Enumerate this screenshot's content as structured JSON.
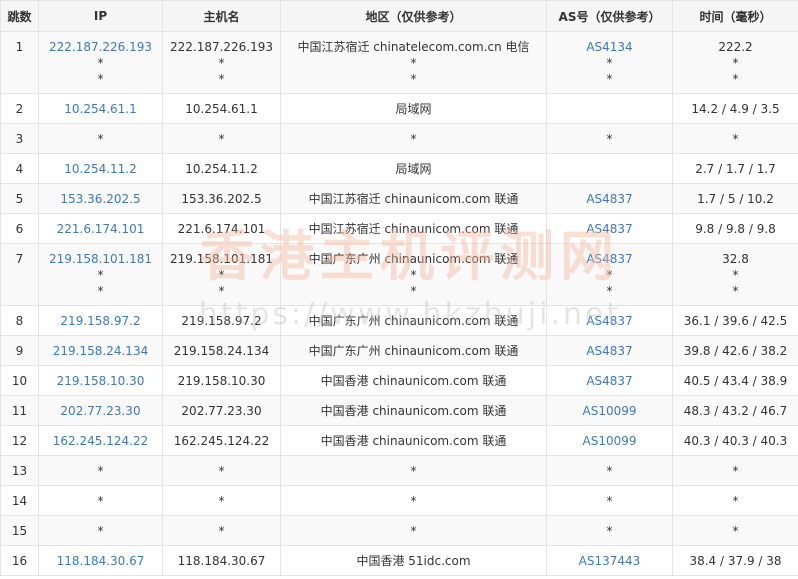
{
  "headers": [
    "跳数",
    "IP",
    "主机名",
    "地区（仅供参考）",
    "AS号（仅供参考）",
    "时间（毫秒）"
  ],
  "rows": [
    {
      "hop": "1",
      "ip": [
        "222.187.226.193",
        "*",
        "*"
      ],
      "host": [
        "222.187.226.193",
        "*",
        "*"
      ],
      "region": [
        "中国江苏宿迁 chinatelecom.com.cn 电信",
        "*",
        "*"
      ],
      "as": [
        "AS4134",
        "*",
        "*"
      ],
      "time": [
        "222.2",
        "*",
        "*"
      ]
    },
    {
      "hop": "2",
      "ip": [
        "10.254.61.1"
      ],
      "host": [
        "10.254.61.1"
      ],
      "region": [
        "局域网"
      ],
      "as": [
        ""
      ],
      "time": [
        "14.2 / 4.9 / 3.5"
      ]
    },
    {
      "hop": "3",
      "ip": [
        "*"
      ],
      "host": [
        "*"
      ],
      "region": [
        "*"
      ],
      "as": [
        "*"
      ],
      "time": [
        "*"
      ]
    },
    {
      "hop": "4",
      "ip": [
        "10.254.11.2"
      ],
      "host": [
        "10.254.11.2"
      ],
      "region": [
        "局域网"
      ],
      "as": [
        ""
      ],
      "time": [
        "2.7 / 1.7 / 1.7"
      ]
    },
    {
      "hop": "5",
      "ip": [
        "153.36.202.5"
      ],
      "host": [
        "153.36.202.5"
      ],
      "region": [
        "中国江苏宿迁 chinaunicom.com 联通"
      ],
      "as": [
        "AS4837"
      ],
      "time": [
        "1.7 / 5 / 10.2"
      ]
    },
    {
      "hop": "6",
      "ip": [
        "221.6.174.101"
      ],
      "host": [
        "221.6.174.101"
      ],
      "region": [
        "中国江苏宿迁 chinaunicom.com 联通"
      ],
      "as": [
        "AS4837"
      ],
      "time": [
        "9.8 / 9.8 / 9.8"
      ]
    },
    {
      "hop": "7",
      "ip": [
        "219.158.101.181",
        "*",
        "*"
      ],
      "host": [
        "219.158.101.181",
        "*",
        "*"
      ],
      "region": [
        "中国广东广州 chinaunicom.com 联通",
        "*",
        "*"
      ],
      "as": [
        "AS4837",
        "*",
        "*"
      ],
      "time": [
        "32.8",
        "*",
        "*"
      ]
    },
    {
      "hop": "8",
      "ip": [
        "219.158.97.2"
      ],
      "host": [
        "219.158.97.2"
      ],
      "region": [
        "中国广东广州 chinaunicom.com 联通"
      ],
      "as": [
        "AS4837"
      ],
      "time": [
        "36.1 / 39.6 / 42.5"
      ]
    },
    {
      "hop": "9",
      "ip": [
        "219.158.24.134"
      ],
      "host": [
        "219.158.24.134"
      ],
      "region": [
        "中国广东广州 chinaunicom.com 联通"
      ],
      "as": [
        "AS4837"
      ],
      "time": [
        "39.8 / 42.6 / 38.2"
      ]
    },
    {
      "hop": "10",
      "ip": [
        "219.158.10.30"
      ],
      "host": [
        "219.158.10.30"
      ],
      "region": [
        "中国香港 chinaunicom.com 联通"
      ],
      "as": [
        "AS4837"
      ],
      "time": [
        "40.5 / 43.4 / 38.9"
      ]
    },
    {
      "hop": "11",
      "ip": [
        "202.77.23.30"
      ],
      "host": [
        "202.77.23.30"
      ],
      "region": [
        "中国香港 chinaunicom.com 联通"
      ],
      "as": [
        "AS10099"
      ],
      "time": [
        "48.3 / 43.2 / 46.7"
      ]
    },
    {
      "hop": "12",
      "ip": [
        "162.245.124.22"
      ],
      "host": [
        "162.245.124.22"
      ],
      "region": [
        "中国香港 chinaunicom.com 联通"
      ],
      "as": [
        "AS10099"
      ],
      "time": [
        "40.3 / 40.3 / 40.3"
      ]
    },
    {
      "hop": "13",
      "ip": [
        "*"
      ],
      "host": [
        "*"
      ],
      "region": [
        "*"
      ],
      "as": [
        "*"
      ],
      "time": [
        "*"
      ]
    },
    {
      "hop": "14",
      "ip": [
        "*"
      ],
      "host": [
        "*"
      ],
      "region": [
        "*"
      ],
      "as": [
        "*"
      ],
      "time": [
        "*"
      ]
    },
    {
      "hop": "15",
      "ip": [
        "*"
      ],
      "host": [
        "*"
      ],
      "region": [
        "*"
      ],
      "as": [
        "*"
      ],
      "time": [
        "*"
      ]
    },
    {
      "hop": "16",
      "ip": [
        "118.184.30.67"
      ],
      "host": [
        "118.184.30.67"
      ],
      "region": [
        "中国香港 51idc.com"
      ],
      "as": [
        "AS137443"
      ],
      "time": [
        "38.4 / 37.9 / 38"
      ]
    }
  ],
  "watermark": {
    "title": "香港主机评测网",
    "url": "https://www.hkzhuji.net"
  },
  "colors": {
    "link": "#3a7ac2",
    "header_bg": "#f5f5f5",
    "stripe_bg": "#f9f9f9",
    "border": "#e4e4e4",
    "text": "#333333"
  }
}
